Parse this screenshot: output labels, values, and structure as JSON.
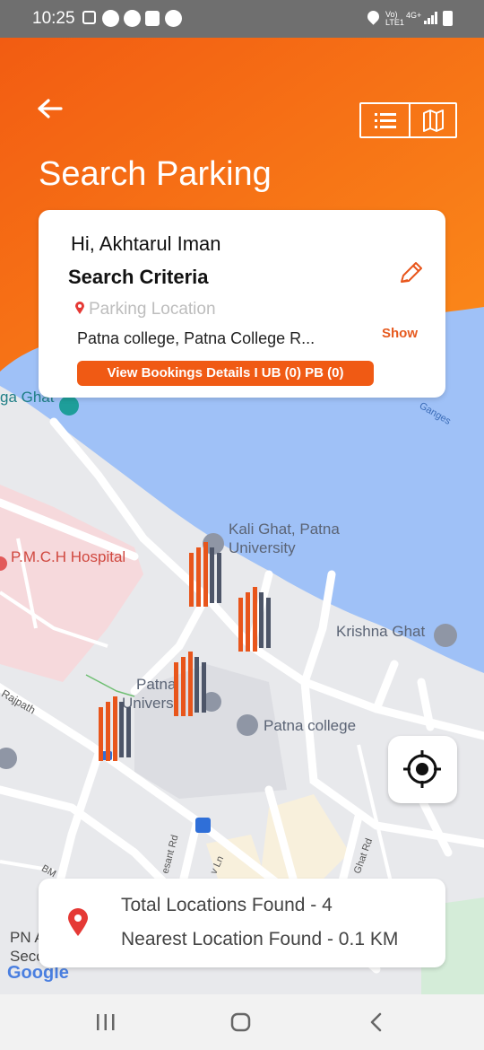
{
  "status_bar": {
    "time": "10:25",
    "network": "4G+",
    "volte": "Vo) LTE1"
  },
  "header": {
    "title": "Search Parking"
  },
  "card": {
    "greeting": "Hi, Akhtarul Iman",
    "criteria_title": "Search Criteria",
    "location_label": "Parking Location",
    "location_value": "Patna college, Patna College R...",
    "show_label": "Show",
    "bookings_button": "View Bookings Details I UB (0) PB (0)"
  },
  "map_labels": {
    "ghat_left": "ga Ghat",
    "ganges": "Ganges",
    "kali_ghat_1": "Kali Ghat, Patna",
    "kali_ghat_2": "University",
    "pmch": "P.M.C.H Hospital",
    "krishna_ghat": "Krishna Ghat",
    "patna_univ_1": "Patna",
    "patna_univ_2": "Univers",
    "patna_college": "Patna college",
    "rajpath": "Rajpath",
    "pn_1": "PN A",
    "pn_2": "Seco",
    "google": "Google",
    "besant_rd": "esant Rd",
    "ghat_rd": "Ghat Rd",
    "ln": "v Ln",
    "bm": "BM"
  },
  "summary": {
    "total": "Total Locations Found - 4",
    "nearest": "Nearest Location Found - 0.1 KM"
  },
  "colors": {
    "accent": "#f05a14",
    "water": "#9fc1f7",
    "marker_orange": "#e8551b",
    "marker_gray": "#4d5568"
  }
}
